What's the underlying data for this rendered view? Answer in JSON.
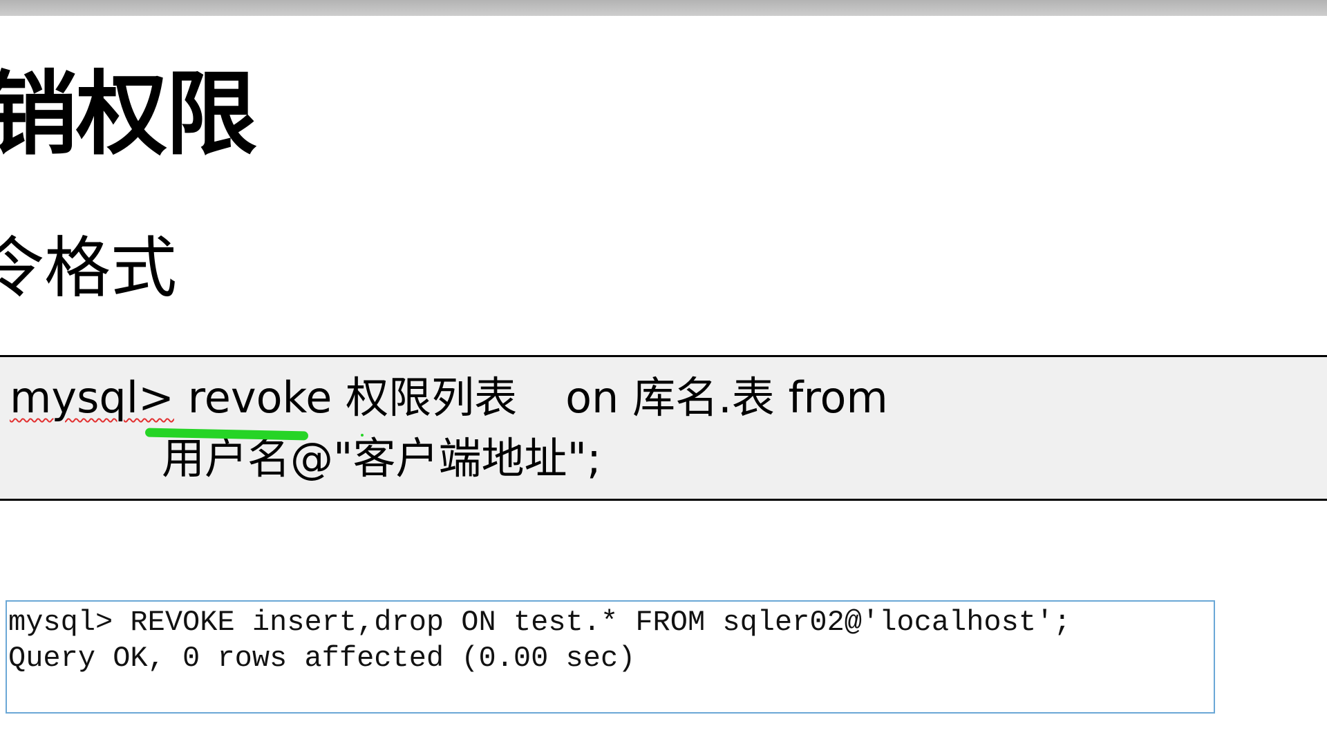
{
  "title": "销权限",
  "subtitle": "令格式",
  "syntax": {
    "prompt": "mysql>",
    "keyword_revoke": "revoke",
    "privileges": "权限列表",
    "keyword_on": "on",
    "target": "库名.表",
    "keyword_from": "from",
    "user_host": "用户名@\"客户端地址\";"
  },
  "terminal": {
    "line1": "mysql> REVOKE insert,drop ON test.* FROM sqler02@'localhost';",
    "line2": "Query OK, 0 rows affected (0.00 sec)"
  },
  "colors": {
    "highlight_mark": "#26d426",
    "syntax_box_bg": "#f0f0f0",
    "terminal_border": "#6aa7d6"
  }
}
